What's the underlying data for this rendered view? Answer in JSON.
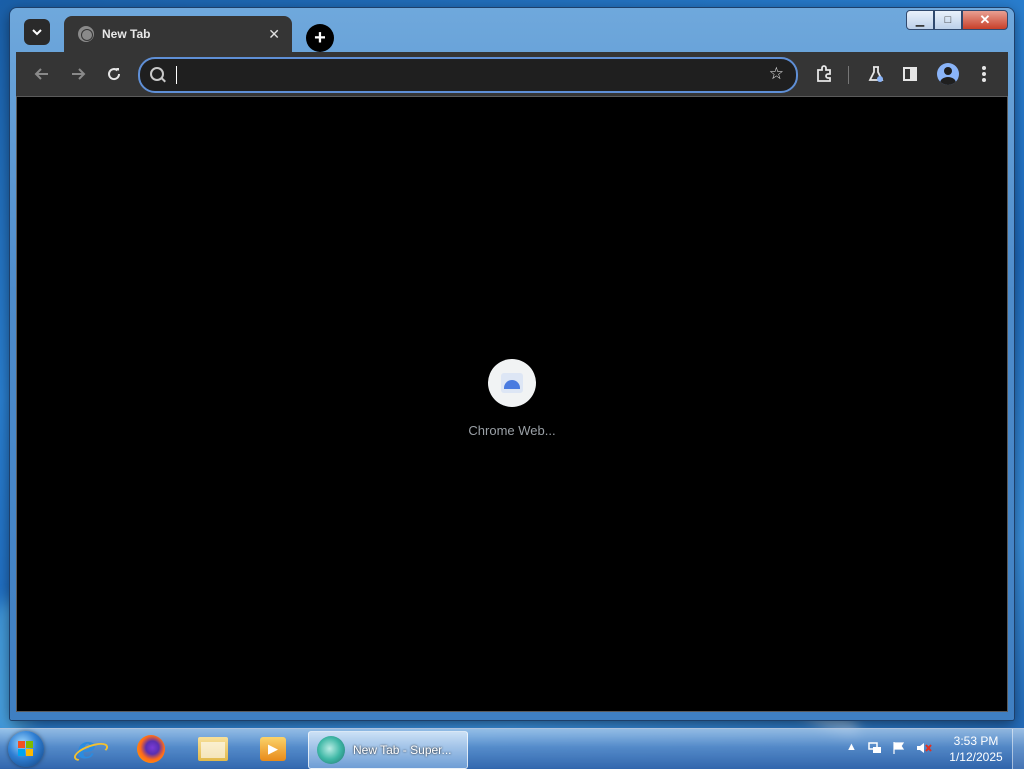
{
  "browser": {
    "tab": {
      "title": "New Tab"
    },
    "tab_close_glyph": "✕",
    "new_tab_glyph": "+",
    "omnibox": {
      "value": "",
      "placeholder": ""
    },
    "icons": [
      "tab-search-icon",
      "back-icon",
      "forward-icon",
      "reload-icon",
      "search-icon",
      "star-icon",
      "extensions-icon",
      "labs-icon",
      "side-panel-icon",
      "profile-icon",
      "menu-icon"
    ]
  },
  "window_controls": {
    "minimize": "▁",
    "maximize": "□",
    "close": "✕"
  },
  "new_tab_page": {
    "shortcuts": [
      {
        "label": "Chrome Web..."
      }
    ]
  },
  "taskbar": {
    "active_task": {
      "label": "New Tab - Super..."
    },
    "clock": {
      "time": "3:53 PM",
      "date": "1/12/2025"
    }
  },
  "colors": {
    "chrome_toolbar": "#353535",
    "omnibox_border": "#5f8fd6",
    "content_bg": "#000000"
  }
}
